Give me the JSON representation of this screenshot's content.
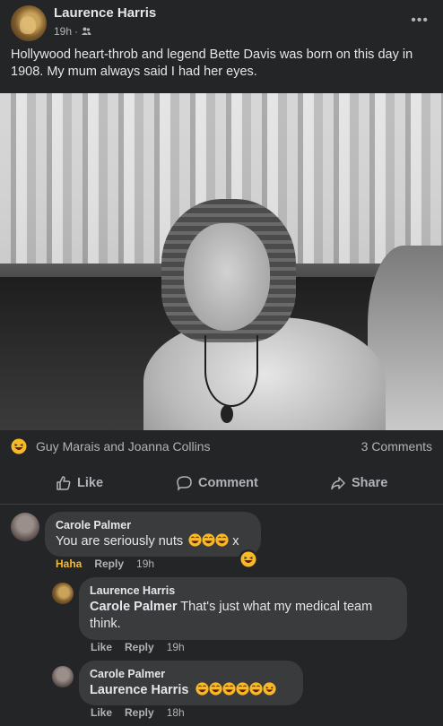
{
  "post": {
    "author": "Laurence Harris",
    "time": "19h",
    "separator": "·",
    "more_label": "•••",
    "text": "Hollywood heart-throb and legend Bette Davis was born on this day in 1908. My mum always said I had her eyes.",
    "reaction_names": "Guy Marais and Joanna Collins",
    "comments_count": "3 Comments"
  },
  "actions": {
    "like": "Like",
    "comment": "Comment",
    "share": "Share"
  },
  "comments": [
    {
      "author": "Carole Palmer",
      "text": "You are seriously nuts",
      "trailing": "x",
      "reaction_label": "Haha",
      "reply_label": "Reply",
      "time": "19h"
    },
    {
      "author": "Laurence Harris",
      "mention": "Carole Palmer",
      "text": " That's just what my medical team think.",
      "like_label": "Like",
      "reply_label": "Reply",
      "time": "19h"
    },
    {
      "author": "Carole Palmer",
      "mention": "Laurence Harris",
      "like_label": "Like",
      "reply_label": "Reply",
      "time": "18h"
    }
  ],
  "colors": {
    "background": "#242526",
    "bubble": "#3a3b3c",
    "text": "#e4e6eb",
    "muted": "#b0b3b8",
    "haha": "#f7b928"
  },
  "icons": [
    "more-icon",
    "friends-audience-icon",
    "haha-reaction-icon",
    "like-icon",
    "comment-icon",
    "share-icon"
  ]
}
